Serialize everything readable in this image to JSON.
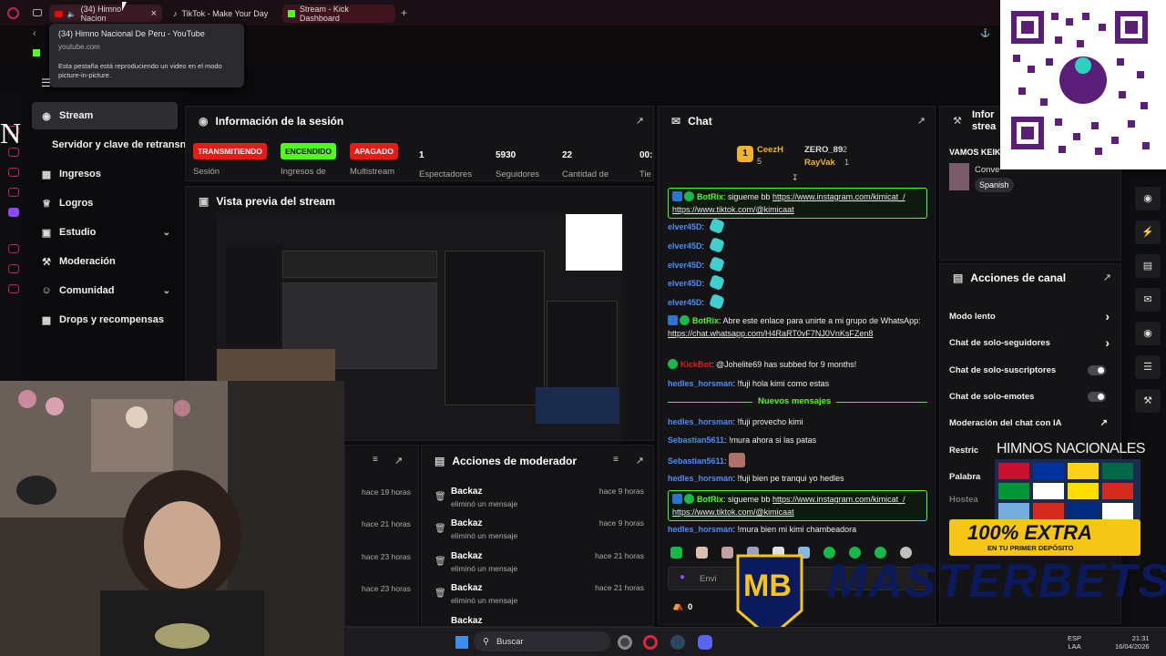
{
  "browser": {
    "tabs": [
      {
        "label": "(34) Himno Nacion",
        "icon": "youtube-icon"
      },
      {
        "label": "TikTok - Make Your Day",
        "icon": "tiktok-icon"
      },
      {
        "label": "Stream - Kick Dashboard",
        "icon": "kick-icon"
      }
    ],
    "tooltip": {
      "title": "(34) Himno Nacional De Peru - YouTube",
      "domain": "youtube.com",
      "note": "Esta pestaña está reproduciendo un video en el modo picture-in-picture."
    }
  },
  "sidebar": {
    "letter": "N",
    "items": [
      {
        "label": "Stream",
        "icon": "broadcast-icon"
      },
      {
        "label": "Servidor y clave de retransn"
      },
      {
        "label": "Ingresos",
        "icon": "dollar-icon"
      },
      {
        "label": "Logros",
        "icon": "trophy-icon"
      },
      {
        "label": "Estudio",
        "icon": "studio-icon"
      },
      {
        "label": "Moderación",
        "icon": "gavel-icon"
      },
      {
        "label": "Comunidad",
        "icon": "people-icon"
      },
      {
        "label": "Drops y recompensas",
        "icon": "gift-icon"
      }
    ]
  },
  "session": {
    "title": "Información de la sesión",
    "stats": [
      {
        "badge": "TRANSMITIENDO",
        "color": "#e91916",
        "label": "Sesión"
      },
      {
        "badge": "ENCENDIDO",
        "color": "#53fc18",
        "label": "Ingresos de"
      },
      {
        "badge": "APAGADO",
        "color": "#e91916",
        "label": "Multistream"
      },
      {
        "num": "1",
        "label": "Espectadores"
      },
      {
        "num": "5930",
        "label": "Seguidores"
      },
      {
        "num": "22",
        "label": "Cantidad de"
      },
      {
        "num": "00:",
        "label": "Tie"
      }
    ]
  },
  "preview": {
    "title": "Vista previa del stream"
  },
  "modactions": {
    "title": "Acciones de moderador",
    "rows": [
      {
        "who": "Backaz",
        "what": "eliminó un mensaje",
        "when": "hace 9 horas"
      },
      {
        "who": "Backaz",
        "what": "eliminó un mensaje",
        "when": "hace 9 horas"
      },
      {
        "who": "Backaz",
        "what": "eliminó un mensaje",
        "when": "hace 21 horas"
      },
      {
        "who": "Backaz",
        "what": "eliminó un mensaje",
        "when": "hace 21 horas"
      },
      {
        "who": "Backaz",
        "what": "",
        "when": ""
      }
    ],
    "left_times": [
      "hace 19 horas",
      "hace 21 horas",
      "hace 23 horas",
      "hace 23 horas"
    ]
  },
  "chat": {
    "title": "Chat",
    "top": [
      {
        "name": "CeezH",
        "count": "5"
      },
      {
        "name": "ZERO_89",
        "count": "2"
      },
      {
        "name": "RayVak",
        "count": "1"
      }
    ],
    "messages": [
      {
        "user": "BotRix",
        "text": "sigueme bb ",
        "link1": "https://www.instagram.com/kimicat_/",
        "link2": "https://www.tiktok.com/@kimicaat"
      },
      {
        "user": "elver45D"
      },
      {
        "user": "elver45D"
      },
      {
        "user": "elver45D"
      },
      {
        "user": "elver45D"
      },
      {
        "user": "elver45D"
      },
      {
        "user": "BotRix",
        "text": "Abre este enlace para unirte a mi grupo de WhatsApp:",
        "link1": "https://chat.whatsapp.com/H4RaRT0vF7NJ0VnKsFZen8"
      },
      {
        "user": "KickBot",
        "text": "@Johelite69 has subbed for 9 months!"
      },
      {
        "user": "hedles_horsman",
        "text": "!fuji hola kimi como estas"
      },
      {
        "divider": "Nuevos mensajes"
      },
      {
        "user": "hedles_horsman",
        "text": "!fuji provecho kimi"
      },
      {
        "user": "Sebastian5611",
        "text": "!mura ahora si las patas"
      },
      {
        "user": "Sebastian5611"
      },
      {
        "user": "hedles_horsman",
        "text": "!fuji bien pe tranqui yo hedles"
      },
      {
        "user": "BotRix",
        "text": "sigueme bb ",
        "link1": "https://www.instagram.com/kimicat_/",
        "link2": "https://www.tiktok.com/@kimicaat"
      },
      {
        "user": "hedles_horsman",
        "text": "!mura bien mi kimi chambeadora"
      }
    ],
    "input_placeholder": "Envi",
    "points": "0"
  },
  "info": {
    "title": "Infor strea",
    "stream_title": "VAMOS KEIK",
    "category": "Conve",
    "language": "Spanish"
  },
  "channel_actions": {
    "title": "Acciones de canal",
    "rows": [
      {
        "label": "Modo lento",
        "kind": "chevron"
      },
      {
        "label": "Chat de solo-seguidores",
        "kind": "chevron"
      },
      {
        "label": "Chat de solo-suscriptores",
        "kind": "toggle"
      },
      {
        "label": "Chat de solo-emotes",
        "kind": "toggle"
      },
      {
        "label": "Moderación del chat con IA",
        "kind": "link"
      },
      {
        "label": "Restric",
        "kind": "none"
      },
      {
        "label": "Palabra",
        "kind": "none"
      },
      {
        "label": "Hostea",
        "kind": "none"
      }
    ]
  },
  "ad": {
    "himnos": "HIMNOS NACIONALES",
    "extra": "100% EXTRA",
    "extra_sub": "EN TU PRIMER DEPÓSITO",
    "brand": "MASTERBETS",
    "mb": "MB"
  },
  "taskbar": {
    "search": "Buscar",
    "lang1": "ESP",
    "lang2": "LAA",
    "time": "21:31",
    "date": "16/04/2026"
  }
}
